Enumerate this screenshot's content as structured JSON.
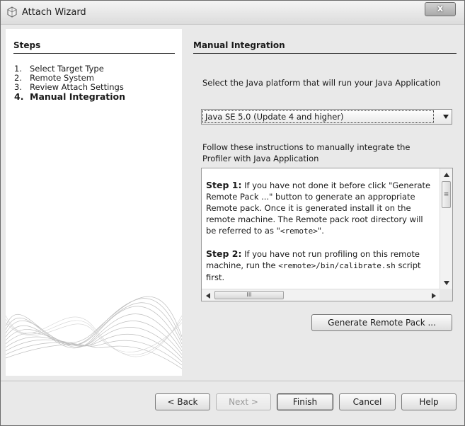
{
  "window": {
    "title": "Attach Wizard",
    "close_label": "x"
  },
  "steps": {
    "heading": "Steps",
    "items": [
      {
        "num": "1.",
        "label": "Select Target Type"
      },
      {
        "num": "2.",
        "label": "Remote System"
      },
      {
        "num": "3.",
        "label": "Review Attach Settings"
      },
      {
        "num": "4.",
        "label": "Manual Integration"
      }
    ],
    "current_index": 3
  },
  "content": {
    "heading": "Manual Integration",
    "platform_prompt": "Select the Java platform that will run your Java Application",
    "platform_selected": "Java SE 5.0 (Update 4 and higher)",
    "follow_instructions": "Follow these instructions to manually integrate the Profiler with Java Application",
    "instructions": {
      "step1_label": "Step 1:",
      "step1_text_a": " If you have not done it before click \"Generate Remote Pack ...\" button to generate an appropriate Remote pack. Once it is generated install it on the remote machine. The Remote pack root directory will be referred to as \"",
      "step1_code": "<remote>",
      "step1_text_b": "\".",
      "step2_label": "Step 2:",
      "step2_text_a": " If you have not run profiling on this remote machine, run the ",
      "step2_code": "<remote>/bin/calibrate.sh",
      "step2_text_b": " script first."
    },
    "generate_button": "Generate Remote Pack ..."
  },
  "footer": {
    "back": "< Back",
    "next": "Next >",
    "finish": "Finish",
    "cancel": "Cancel",
    "help": "Help"
  },
  "colors": {
    "window_bg": "#e9e9e9",
    "panel_bg": "#ffffff",
    "disabled_text": "#9a9a9a"
  }
}
